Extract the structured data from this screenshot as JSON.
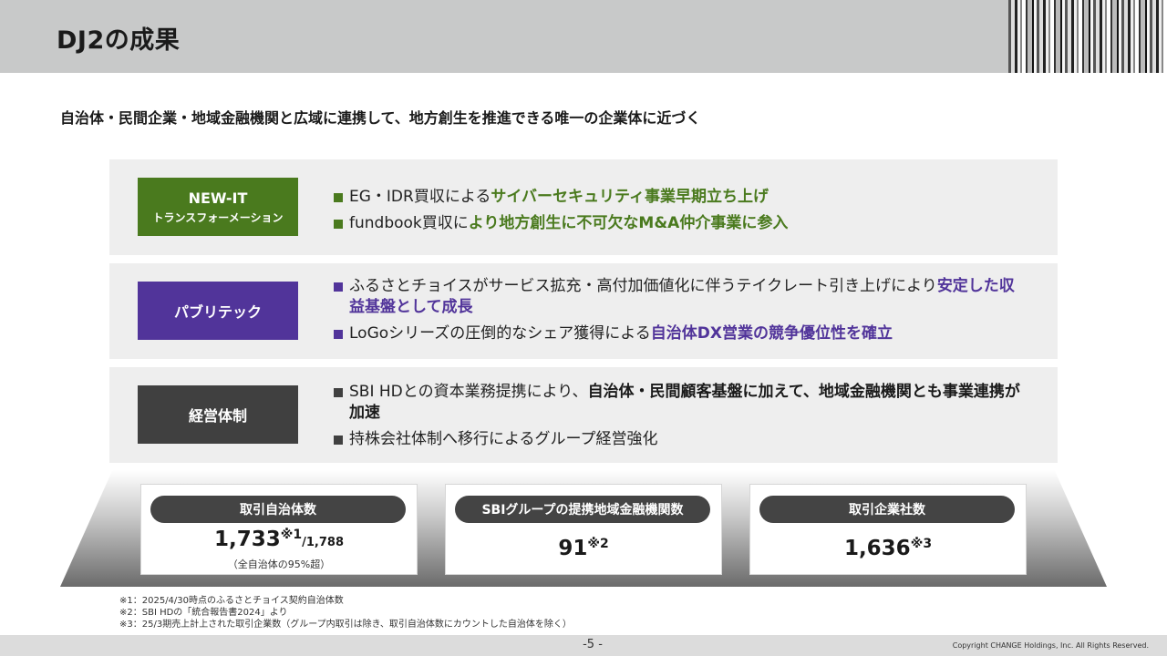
{
  "header": {
    "title": "DJ2の成果"
  },
  "subtitle": "自治体・民間企業・地域金融機関と広域に連携して、地方創生を推進できる唯一の企業体に近づく",
  "sections": [
    {
      "label_main": "NEW-IT",
      "label_sub": "トランスフォーメーション",
      "color": "#4a7a1e",
      "bullets": [
        {
          "plain": "EG・IDR買収による",
          "emphasis": "サイバーセキュリティ事業早期立ち上げ"
        },
        {
          "plain": "fundbook買収に",
          "emphasis": "より地方創生に不可欠なM&A仲介事業に参入"
        }
      ]
    },
    {
      "label_main": "パブリテック",
      "color": "#51349a",
      "bullets": [
        {
          "plain": "ふるさとチョイスがサービス拡充・高付加価値化に伴うテイクレート引き上げにより",
          "emphasis": "安定した収益基盤として成長"
        },
        {
          "plain": "LoGoシリーズの圧倒的なシェア獲得による",
          "emphasis": "自治体DX営業の競争優位性を確立"
        }
      ]
    },
    {
      "label_main": "経営体制",
      "color": "#404040",
      "bullets": [
        {
          "plain": "SBI HDとの資本業務提携により、",
          "emphasis": "自治体・民間顧客基盤に加えて、地域金融機関とも事業連携が加速"
        },
        {
          "plain": "持株会社体制へ移行によるグループ経営強化",
          "emphasis": ""
        }
      ]
    }
  ],
  "stats": [
    {
      "label": "取引自治体数",
      "value": "1,733",
      "sup": "※1",
      "suffix": "/1,788",
      "note": "（全自治体の95%超）"
    },
    {
      "label": "SBIグループの提携地域金融機関数",
      "value": "91",
      "sup": "※2"
    },
    {
      "label": "取引企業社数",
      "value": "1,636",
      "sup": "※3"
    }
  ],
  "footnotes": [
    "※1：2025/4/30時点のふるさとチョイス契約自治体数",
    "※2：SBI HDの「統合報告書2024」より",
    "※3：25/3期売上計上された取引企業数（グループ内取引は除き、取引自治体数にカウントした自治体を除く）"
  ],
  "footer": {
    "page": "-5 -",
    "copyright": "Copyright CHANGE Holdings, Inc. All Rights Reserved."
  }
}
